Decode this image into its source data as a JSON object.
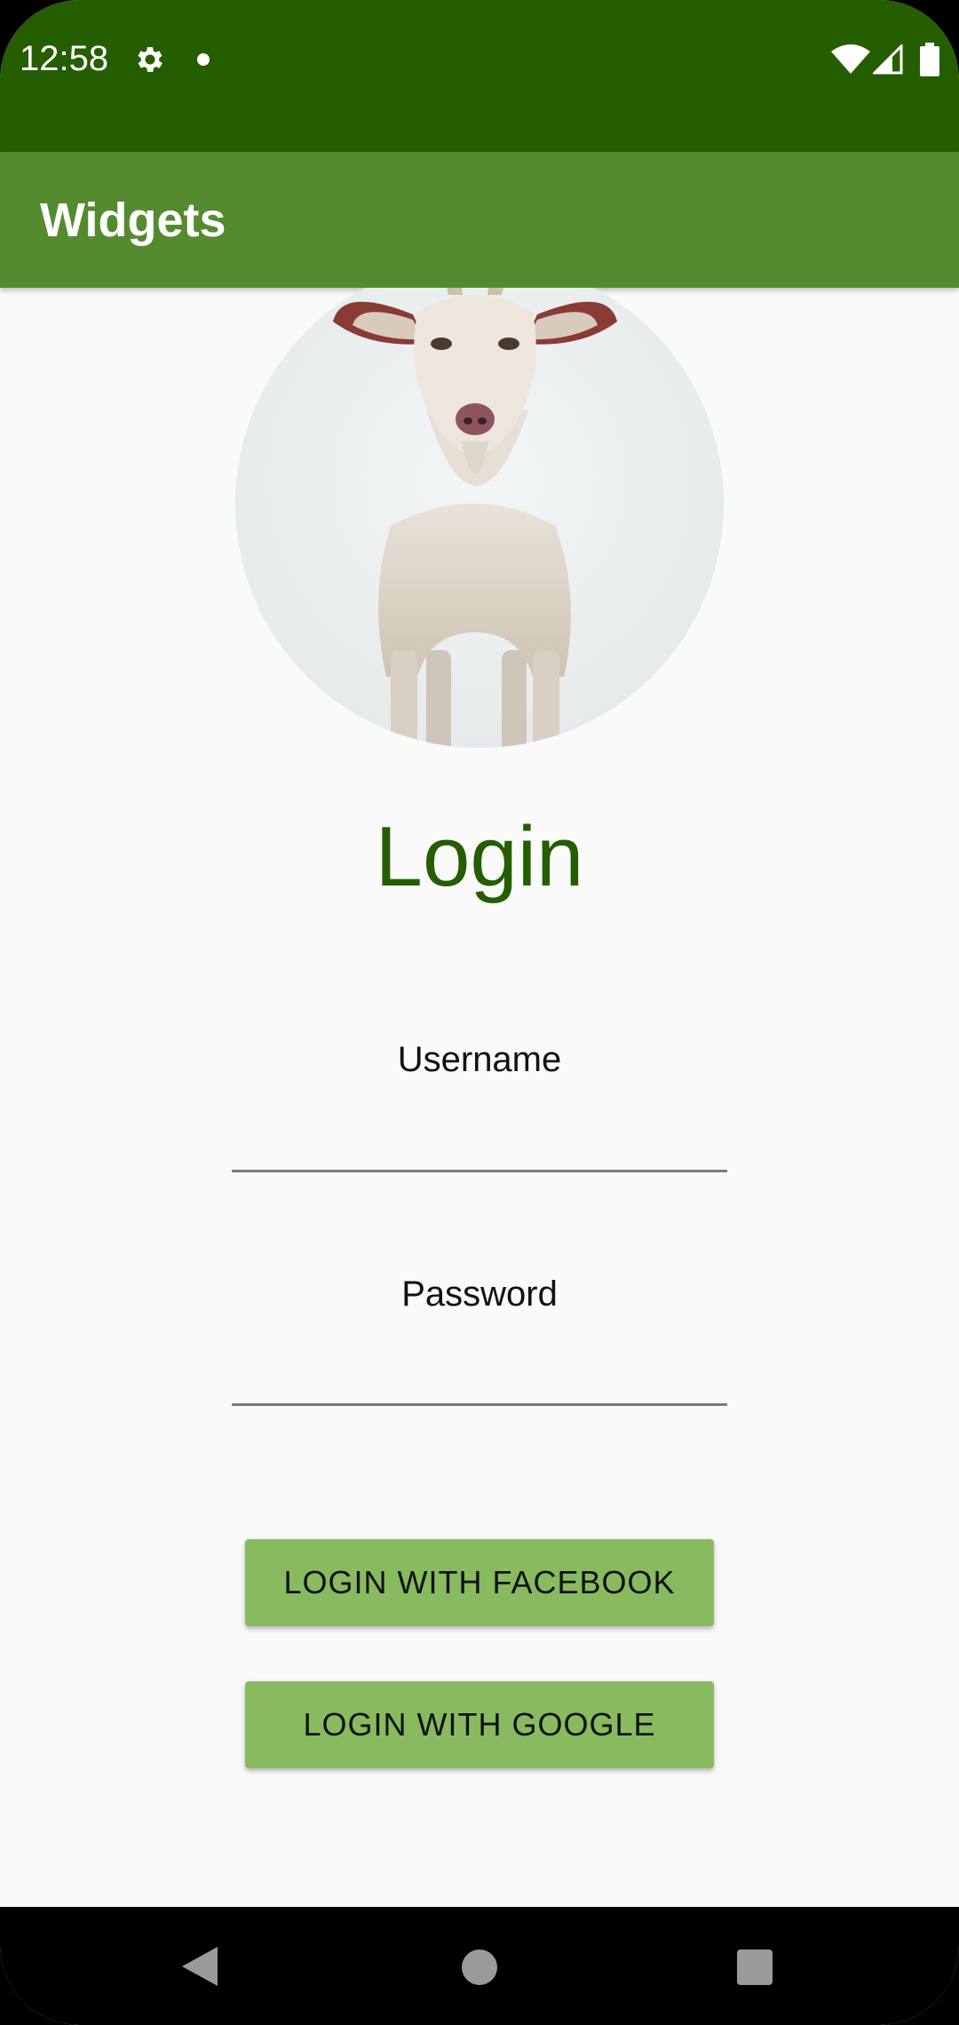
{
  "status_bar": {
    "time": "12:58",
    "icons": [
      "gear-icon",
      "notification-dot-icon",
      "wifi-icon",
      "signal-icon",
      "battery-icon"
    ]
  },
  "app_bar": {
    "title": "Widgets"
  },
  "avatar": {
    "description_icon": "goat-photo"
  },
  "login": {
    "title": "Login",
    "username_label": "Username",
    "username_value": "",
    "password_label": "Password",
    "password_value": "",
    "facebook_button": "LOGIN WITH FACEBOOK",
    "google_button": "LOGIN WITH GOOGLE"
  },
  "nav_bar": {
    "icons": [
      "back-icon",
      "home-icon",
      "recents-icon"
    ]
  },
  "colors": {
    "status_bar": "#255e00",
    "app_bar": "#558b2f",
    "accent_text": "#255e00",
    "button": "#88bb5f",
    "background": "#fafafa"
  }
}
